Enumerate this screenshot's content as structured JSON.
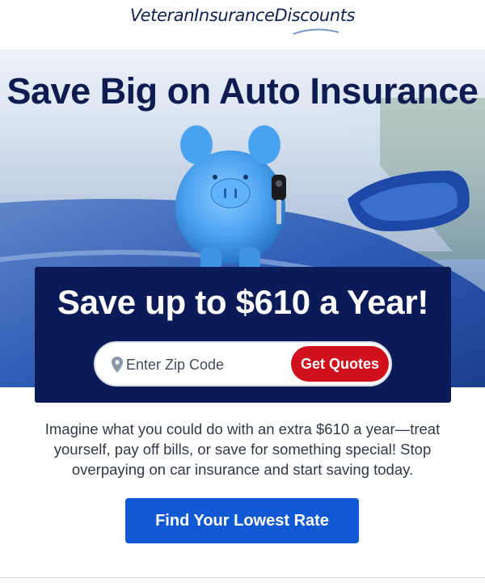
{
  "header": {
    "logo_text": "VeteranInsuranceDiscounts"
  },
  "hero": {
    "title": "Save Big on Auto Insurance",
    "image_icon": "piggy-bank-with-car-keys-on-car-hood"
  },
  "offer": {
    "title": "Save up to $610 a Year!",
    "zip_placeholder": "Enter Zip Code",
    "zip_icon": "location-pin-icon",
    "submit_label": "Get Quotes"
  },
  "body": {
    "text": "Imagine what you could do with an extra $610 a year—treat yourself, pay off bills, or save for something special! Stop overpaying on car insurance and start saving today."
  },
  "cta": {
    "label": "Find Your Lowest Rate"
  },
  "colors": {
    "navy": "#0b1b57",
    "red": "#d0101c",
    "blue": "#1159d4",
    "piggy_blue": "#4aa3f0"
  }
}
